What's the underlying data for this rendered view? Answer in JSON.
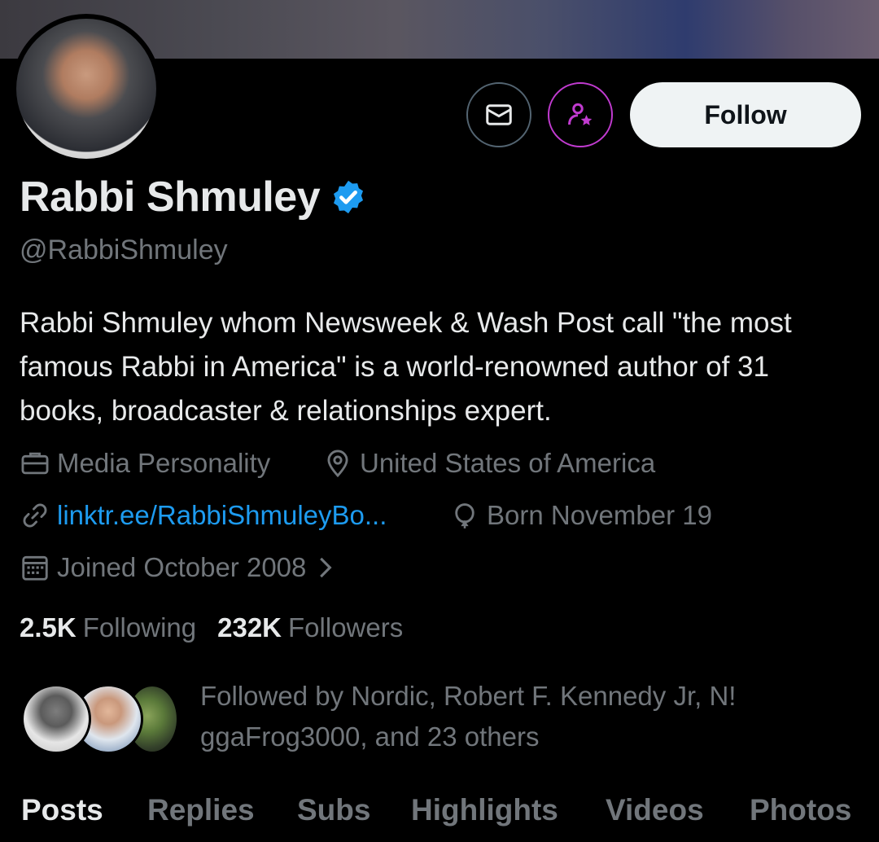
{
  "profile": {
    "display_name": "Rabbi Shmuley",
    "handle": "@RabbiShmuley",
    "bio": "Rabbi Shmuley whom Newsweek & Wash Post call \"the most famous Rabbi in America\" is a world-renowned author of 31 books, broadcaster & relationships expert.",
    "category": "Media Personality",
    "location": "United States of America",
    "link": "linktr.ee/RabbiShmuleyBo...",
    "birthday": "Born November 19",
    "joined": "Joined October 2008",
    "verified": true
  },
  "actions": {
    "follow_label": "Follow",
    "message_icon": "mail-icon",
    "subscribe_icon": "subscribe-person-star-icon"
  },
  "stats": {
    "following_count": "2.5K",
    "following_label": "Following",
    "followers_count": "232K",
    "followers_label": "Followers"
  },
  "followed_by": {
    "line1": "Followed by Nordic, Robert F. Kennedy Jr, N!",
    "line2": "ggaFrog3000, and 23 others"
  },
  "tabs": [
    {
      "label": "Posts",
      "active": true
    },
    {
      "label": "Replies",
      "active": false
    },
    {
      "label": "Subs",
      "active": false
    },
    {
      "label": "Highlights",
      "active": false
    },
    {
      "label": "Videos",
      "active": false
    },
    {
      "label": "Photos",
      "active": false
    }
  ],
  "colors": {
    "background": "#000000",
    "text_primary": "#e7e9ea",
    "text_secondary": "#71767b",
    "link": "#1d9bf0",
    "verified": "#1d9bf0",
    "subscribe_accent": "#c13bd0",
    "follow_bg": "#eff3f4"
  }
}
